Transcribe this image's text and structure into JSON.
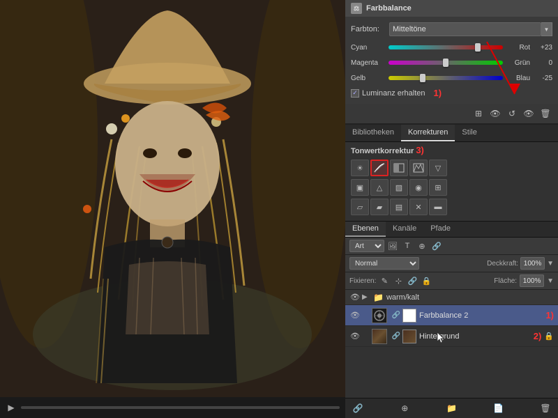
{
  "header": {
    "title": "Farbbalance",
    "icon": "⚖"
  },
  "farbbalance": {
    "farbton_label": "Farbton:",
    "farbton_value": "Mitteltöne",
    "sliders": [
      {
        "left": "Cyan",
        "right": "Rot",
        "value": "+23",
        "thumb_pct": 78,
        "type": "cyan-rot"
      },
      {
        "left": "Magenta",
        "right": "Grün",
        "value": "0",
        "thumb_pct": 50,
        "type": "magenta-gruen"
      },
      {
        "left": "Gelb",
        "right": "Blau",
        "value": "-25",
        "thumb_pct": 30,
        "type": "gelb-blau"
      }
    ],
    "luminanz_label": "Luminanz erhalten",
    "luminanz_checked": true,
    "annotation_1": "1)"
  },
  "tabs": {
    "items": [
      "Bibliotheken",
      "Korrekturen",
      "Stile"
    ],
    "active": "Korrekturen"
  },
  "korrekturen": {
    "title": "Tonwertkorrektur",
    "annotation_3": "3)",
    "icons_row1": [
      "☀",
      "🌙",
      "⚡",
      "◪",
      "▽"
    ],
    "icons_row2": [
      "▣",
      "△",
      "▨",
      "◉",
      "⊞"
    ],
    "icons_row3": [
      "▱",
      "▰",
      "▤",
      "✕",
      "▬"
    ],
    "highlighted_index": 1
  },
  "ebenen": {
    "tabs": [
      "Ebenen",
      "Kanäle",
      "Pfade"
    ],
    "active_tab": "Ebenen",
    "art_label": "Art",
    "blend_mode": "Normal",
    "deckkraft_label": "Deckkraft:",
    "deckkraft_value": "100%",
    "fixieren_label": "Fixieren:",
    "flaeche_label": "Fläche:",
    "flaeche_value": "100%",
    "layers": [
      {
        "type": "group",
        "name": "warm/kalt",
        "visible": true
      },
      {
        "type": "adjustment",
        "name": "Farbbalance 2",
        "visible": true,
        "selected": true,
        "annotation": "1)"
      },
      {
        "type": "image",
        "name": "Hintergrund",
        "visible": true,
        "selected": false,
        "annotation": "2)",
        "locked": true
      }
    ],
    "bottom_icons": [
      "📄",
      "🎨",
      "⊕",
      "⊞",
      "🗑"
    ]
  },
  "toolbar": {
    "icons": [
      "⊞",
      "👁",
      "↺",
      "👁",
      "🗑"
    ]
  }
}
